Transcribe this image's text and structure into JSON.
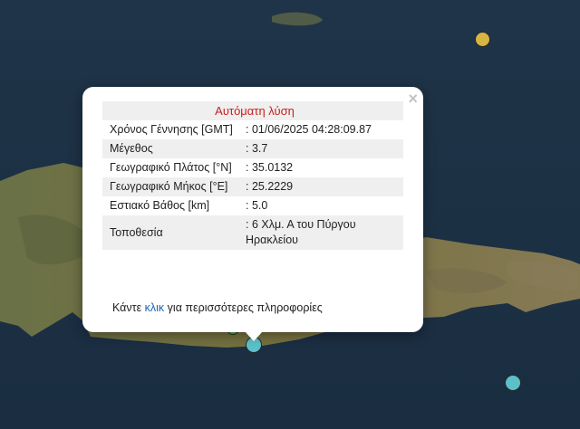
{
  "popup": {
    "title": "Αυτόματη λύση",
    "close_symbol": "×",
    "rows": [
      {
        "label": "Χρόνος Γέννησης [GMT]",
        "value": ": 01/06/2025 04:28:09.87"
      },
      {
        "label": "Μέγεθος",
        "value": ": 3.7"
      },
      {
        "label": "Γεωγραφικό Πλάτος [°N]",
        "value": ": 35.0132"
      },
      {
        "label": "Γεωγραφικό Μήκος [°E]",
        "value": ": 25.2229"
      },
      {
        "label": "Εστιακό Βάθος [km]",
        "value": ": 5.0"
      },
      {
        "label": "Τοποθεσία",
        "value": ": 6 Χλμ. Α του Πύργου Ηρακλείου"
      }
    ],
    "footer_before": "Κάντε ",
    "footer_link": "κλικ",
    "footer_after": " για περισσότερες πληροφορίες"
  },
  "colors": {
    "marker_yellow": "#d7b545",
    "marker_cyan": "#5cc0c9",
    "marker_green": "#52b04f",
    "title_red": "#c6201c",
    "link_blue": "#1a64b0"
  }
}
